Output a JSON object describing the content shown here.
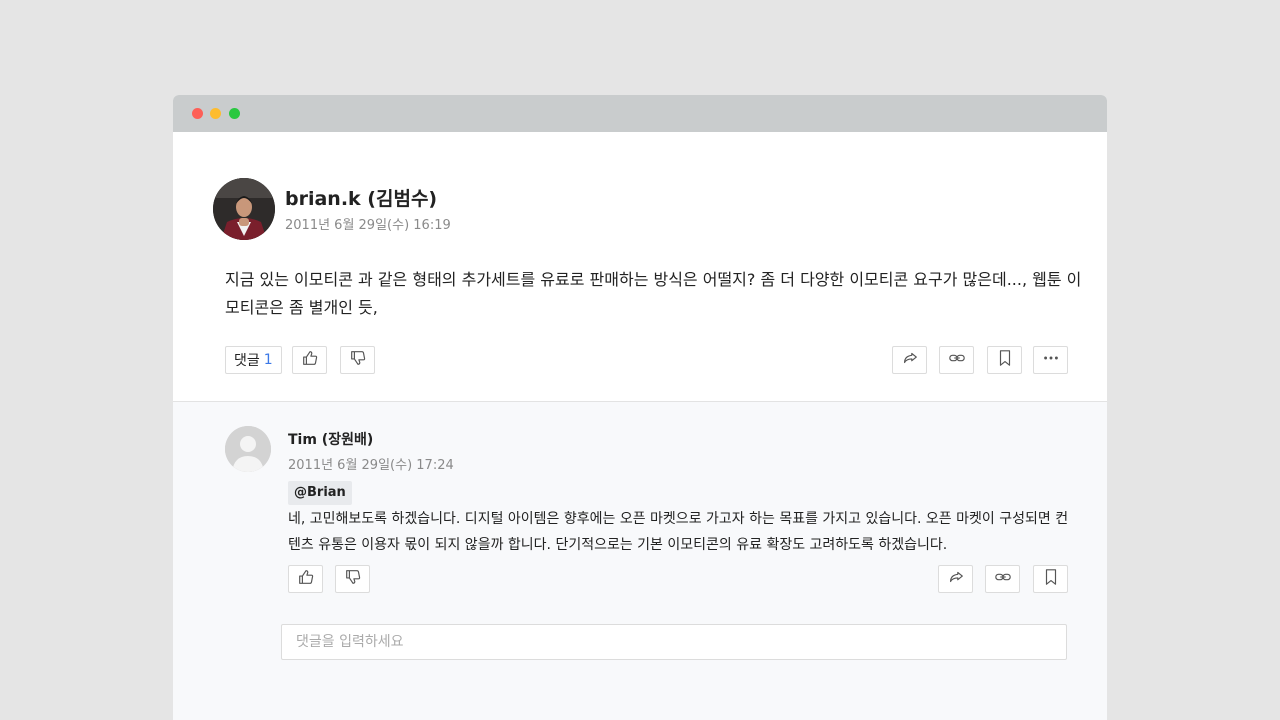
{
  "post": {
    "author": "brian.k (김범수)",
    "date": "2011년 6월 29일(수) 16:19",
    "body": "지금 있는 이모티콘 과 같은 형태의 추가세트를 유료로 판매하는 방식은 어떨지? 좀 더 다양한 이모티콘 요구가 많은데..., 웹툰 이모티콘은 좀 별개인 듯,",
    "comment_label": "댓글",
    "comment_count": "1"
  },
  "comment": {
    "author": "Tim (장원배)",
    "date": "2011년 6월 29일(수) 17:24",
    "mention": "@Brian",
    "body": "네, 고민해보도록 하겠습니다. 디지털 아이템은 향후에는 오픈 마켓으로 가고자 하는 목표를 가지고 있습니다. 오픈 마켓이 구성되면 컨텐츠 유통은 이용자 몫이 되지 않을까 합니다. 단기적으로는 기본 이모티콘의 유료 확장도 고려하도록 하겠습니다."
  },
  "reply": {
    "placeholder": "댓글을 입력하세요"
  },
  "colors": {
    "accent": "#3b78e7",
    "titlebar": "#c9cccd",
    "comment_bg": "#f8f9fb"
  },
  "icons": [
    "thumbs-up-icon",
    "thumbs-down-icon",
    "share-icon",
    "link-icon",
    "bookmark-icon",
    "more-icon",
    "default-avatar-icon"
  ]
}
